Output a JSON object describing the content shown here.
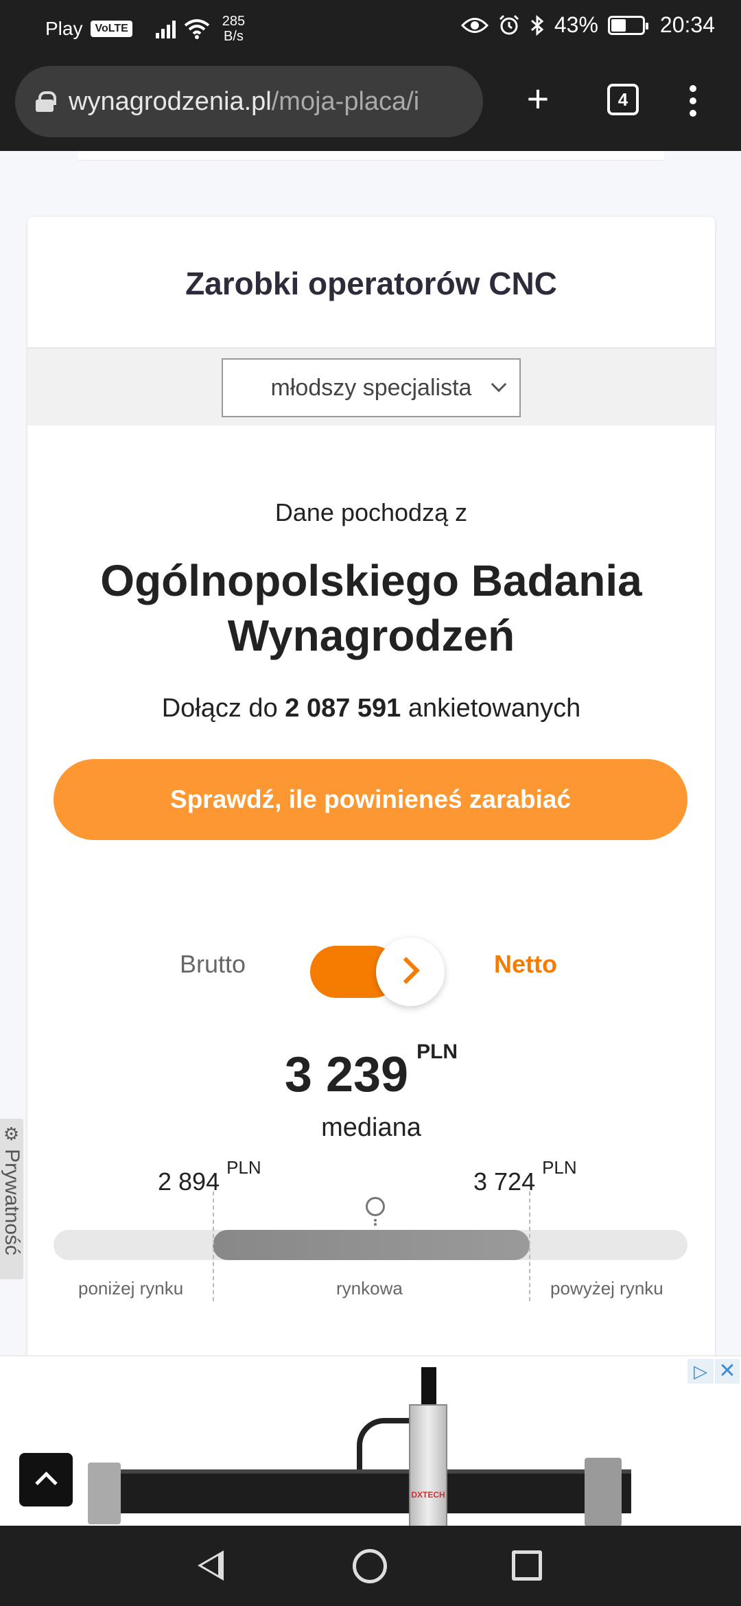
{
  "status_bar": {
    "carrier": "Play",
    "volte": "VoLTE",
    "net_speed_value": "285",
    "net_speed_unit": "B/s",
    "battery": "43%",
    "time": "20:34"
  },
  "browser": {
    "url_host": "wynagrodzenia.pl",
    "url_path": "/moja-placa/i",
    "tab_count": "4"
  },
  "card": {
    "title": "Zarobki operatorów CNC",
    "level_select": "młodszy specjalista",
    "data_from": "Dane pochodzą z",
    "survey_line1": "Ogólnopolskiego Badania",
    "survey_line2": "Wynagrodzeń",
    "join_prefix": "Dołącz do",
    "join_count": "2 087 591",
    "join_suffix": "ankietowanych",
    "cta_label": "Sprawdź, ile powinieneś zarabiać"
  },
  "salary": {
    "toggle_left": "Brutto",
    "toggle_right": "Netto",
    "toggle_state": "Netto",
    "median_value": "3 239",
    "currency": "PLN",
    "median_label": "mediana",
    "low_value": "2 894",
    "high_value": "3 724",
    "zone_below": "poniżej rynku",
    "zone_market": "rynkowa",
    "zone_above": "powyżej rynku"
  },
  "privacy_tab": "Prywatność",
  "ad": {
    "brand_mark": "DXTECH"
  }
}
